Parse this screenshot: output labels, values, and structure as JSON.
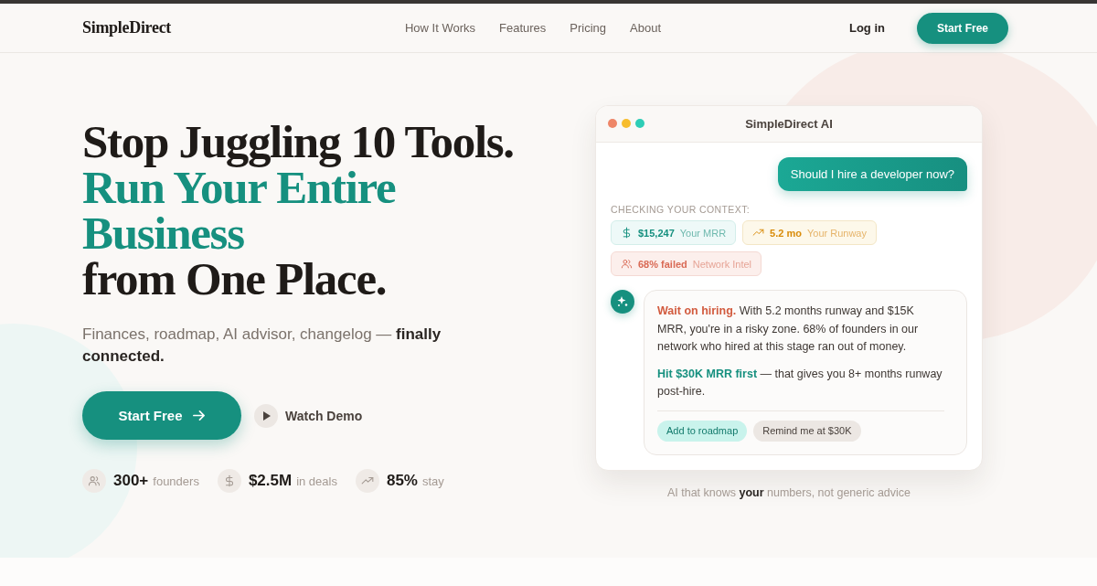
{
  "nav": {
    "logo": "SimpleDirect",
    "links": [
      "How It Works",
      "Features",
      "Pricing",
      "About"
    ],
    "login": "Log in",
    "cta": "Start Free"
  },
  "hero": {
    "headline": [
      {
        "text": "Stop Juggling 10 Tools.",
        "kind": "plain"
      },
      {
        "text": "Run Your Entire",
        "kind": "accent"
      },
      {
        "text": "Business",
        "kind": "accent"
      },
      {
        "text": "from One Place.",
        "kind": "plain"
      }
    ],
    "subtitle": "Finances, roadmap, AI advisor, changelog — **finally connected.**",
    "primary_button": "Start Free",
    "demo_button": "Watch Demo",
    "stats": [
      {
        "kind": "people",
        "value": "300+",
        "label": "founders"
      },
      {
        "kind": "dollar",
        "value": "$2.5M",
        "label": "in deals"
      },
      {
        "kind": "trend",
        "value": "85%",
        "label": "stay"
      }
    ]
  },
  "chat": {
    "title": "SimpleDirect AI",
    "dots": [
      {
        "color": "#ee8668"
      },
      {
        "color": "#f7bd2e"
      },
      {
        "color": "#2ecdb6"
      }
    ],
    "question": "Should I hire a developer now?",
    "context_label": "CHECKING YOUR CONTEXT:",
    "chips": [
      {
        "kind": "mrr",
        "value": "$15,247",
        "label": "Your MRR"
      },
      {
        "kind": "runway",
        "value": "5.2 mo",
        "label": "Your Runway"
      },
      {
        "kind": "network",
        "value": "68% failed",
        "label": "Network Intel"
      }
    ],
    "answer": [
      {
        "kind": "warning",
        "text": "**Wait on hiring.** With 5.2 months runway and $15K MRR, you're in a risky zone. 68% of founders in our network who hired at this stage ran out of money."
      },
      {
        "kind": "tip",
        "text": "**Hit $30K MRR first** — that gives you 8+ months runway post-hire."
      }
    ],
    "actions": [
      {
        "kind": "primary",
        "label": "Add to roadmap"
      },
      {
        "kind": "secondary",
        "label": "Remind me at $30K"
      }
    ],
    "caption": "AI that knows **your** numbers, not generic advice"
  }
}
